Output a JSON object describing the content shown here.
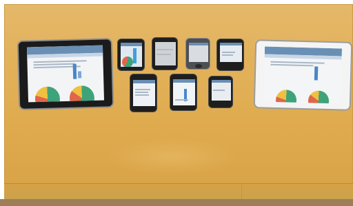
{
  "scene": {
    "table_color": "#e2b25b",
    "screen_accent": "#4a86c8"
  },
  "devices": [
    {
      "name": "tablet-black",
      "icon": "tablet-icon"
    },
    {
      "name": "phone-1",
      "icon": "phone-icon"
    },
    {
      "name": "phone-2",
      "icon": "phone-icon"
    },
    {
      "name": "phone-3",
      "icon": "phone-icon"
    },
    {
      "name": "phone-4",
      "icon": "phone-icon"
    },
    {
      "name": "phone-5",
      "icon": "phone-icon"
    },
    {
      "name": "phone-6",
      "icon": "phone-icon"
    },
    {
      "name": "phone-7",
      "icon": "phone-icon"
    },
    {
      "name": "tablet-white",
      "icon": "tablet-icon"
    }
  ]
}
